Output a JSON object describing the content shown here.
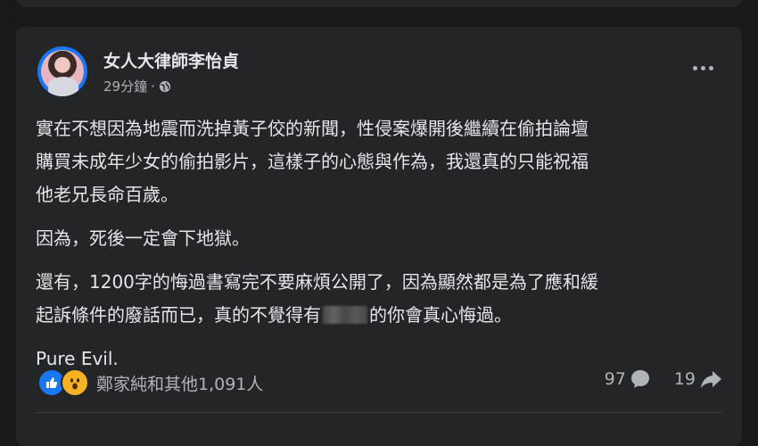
{
  "post": {
    "author": "女人大律師李怡貞",
    "time": "29分鐘",
    "dot": "·",
    "paragraphs": {
      "p1_line1": "實在不想因為地震而洗掉黃子佼的新聞，性侵案爆開後繼續在偷拍論壇",
      "p1_line2": "購買未成年少女的偷拍影片，這樣子的心態與作為，我還真的只能祝福",
      "p1_line3": "他老兄長命百歲。",
      "p2": "因為，死後一定會下地獄。",
      "p3_line1": "還有，1200字的悔過書寫完不要麻煩公開了，因為顯然都是為了應和緩",
      "p3_line2_before": "起訴條件的廢話而已，真的不覺得有",
      "p3_line2_after": "的你會真心悔過。",
      "p4": "Pure Evil."
    }
  },
  "footer": {
    "reactions_text": "鄭家純和其他1,091人",
    "comments_count": "97",
    "shares_count": "19"
  },
  "colors": {
    "background": "#18191a",
    "card": "#242526",
    "text": "#e4e6eb",
    "secondary": "#b0b3b8",
    "like_blue": "#1877f2",
    "wow_yellow": "#f7b125"
  },
  "icons": [
    "globe-icon",
    "more-icon",
    "like-icon",
    "wow-icon",
    "comment-icon",
    "share-icon"
  ]
}
